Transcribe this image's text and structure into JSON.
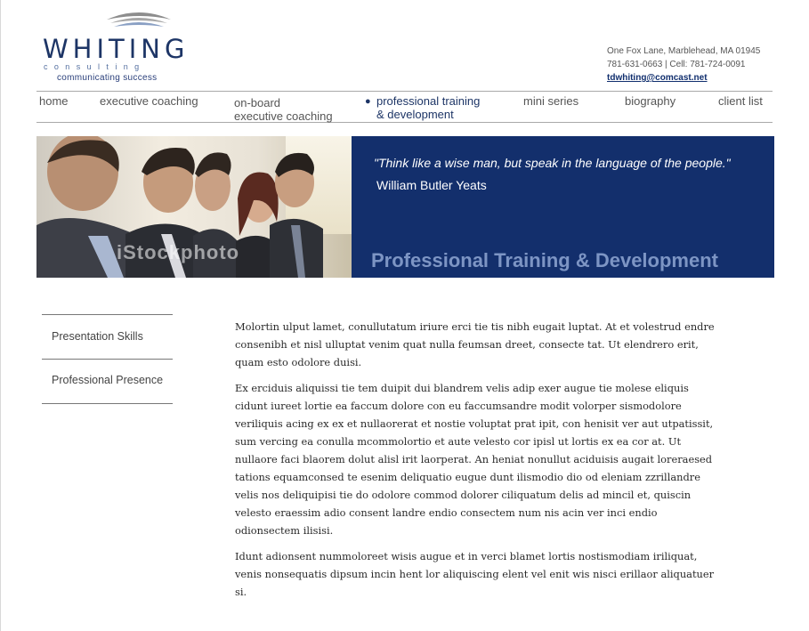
{
  "logo": {
    "wordmark": "WHITING",
    "sub": "consulting",
    "tagline": "communicating success"
  },
  "contact": {
    "address": "One Fox Lane, Marblehead, MA 01945",
    "phones": "781-631-0663 | Cell: 781-724-0091",
    "email": "tdwhiting@comcast.net"
  },
  "nav": {
    "home": "home",
    "executive_coaching": "executive coaching",
    "onboard_line1": "on-board",
    "onboard_line2": "executive coaching",
    "training_line1": "professional training",
    "training_line2": "& development",
    "mini_series": "mini series",
    "biography": "biography",
    "client_list": "client list"
  },
  "banner": {
    "quote": "\"Think like a wise man, but speak in the language of the people.\"",
    "author": "William Butler Yeats",
    "title": "Professional Training & Development",
    "watermark": "iStockphoto"
  },
  "sidebar": {
    "items": [
      "Presentation Skills",
      "Professional Presence"
    ]
  },
  "content": {
    "paragraphs": [
      "Molortin ulput lamet, conullutatum iriure erci tie tis nibh eugait luptat. At et volestrud endre consenibh et nisl ulluptat venim quat nulla feumsan dreet, consecte tat. Ut elendrero erit, quam esto odolore duisi.",
      "Ex erciduis aliquissi tie tem duipit dui blandrem velis adip exer augue tie molese eliquis cidunt iureet lortie ea faccum dolore con eu faccumsandre modit volorper sismodolore veriliquis acing ex ex et nullaorerat et nostie voluptat prat ipit, con henisit ver aut utpatissit, sum vercing ea conulla mcommolortio et aute velesto cor ipisl ut lortis ex ea cor at. Ut nullaore faci blaorem dolut alisl irit laorperat. An heniat nonullut aciduisis augait loreraesed tations equamconsed te esenim deliquatio eugue dunt ilismodio dio od eleniam zzrillandre velis nos deliquipisi tie do odolore commod dolorer ciliquatum delis ad mincil et, quiscin velesto eraessim adio consent landre endio consectem num nis acin ver inci endio odionsectem ilisisi.",
      "Idunt adionsent nummoloreet wisis augue et in verci blamet lortis nostismodiam iriliquat, venis nonsequatis dipsum incin hent lor aliquiscing elent vel enit wis nisci erillaor aliquatuer si."
    ]
  },
  "colors": {
    "navy": "#132f6c",
    "banner_title": "#7d95c4"
  }
}
